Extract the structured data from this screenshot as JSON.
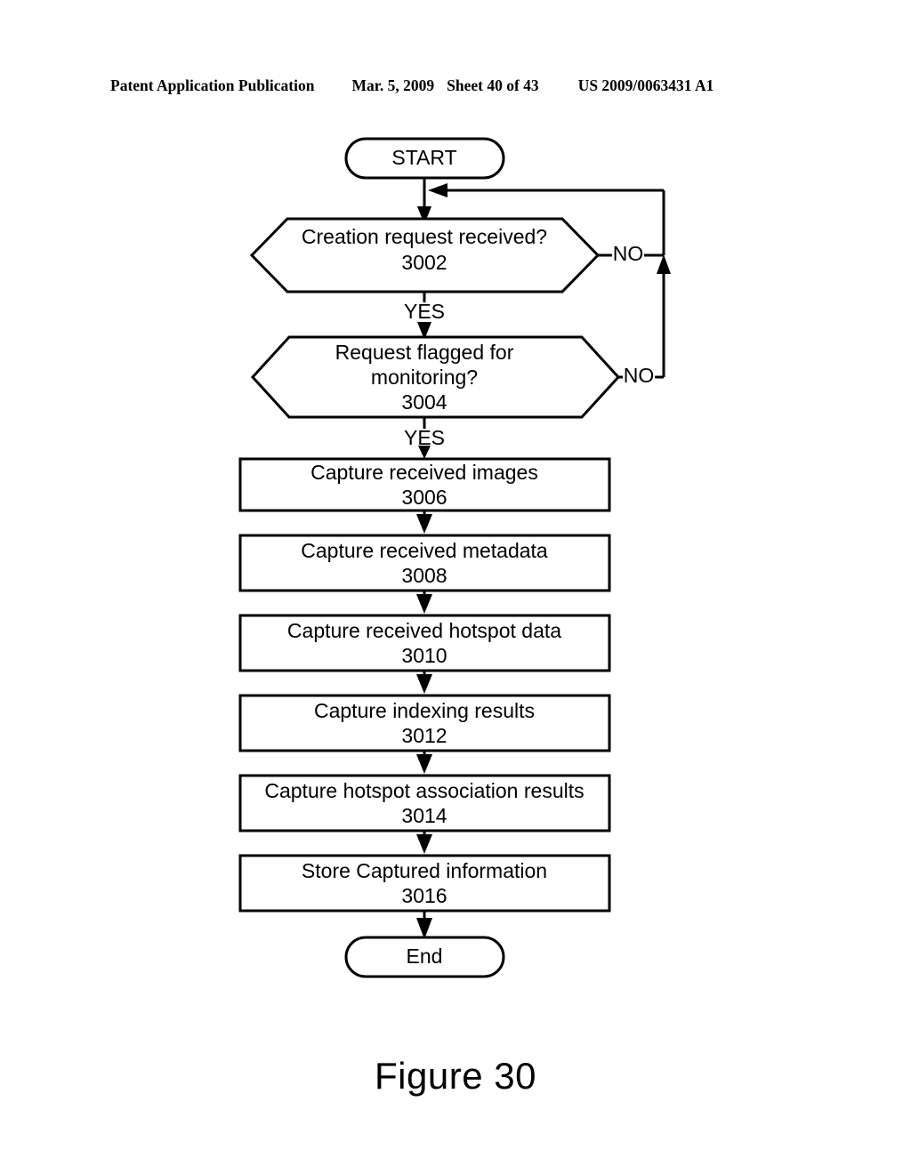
{
  "header": {
    "publication": "Patent Application Publication",
    "date": "Mar. 5, 2009",
    "sheet": "Sheet 40 of 43",
    "patent_number": "US 2009/0063431 A1"
  },
  "figure": {
    "caption": "Figure 30"
  },
  "flowchart": {
    "nodes": [
      {
        "id": "start",
        "type": "terminator",
        "text_line1": "START"
      },
      {
        "id": "3002",
        "type": "decision",
        "text_line1": "Creation request received?",
        "text_line2": "3002"
      },
      {
        "id": "3004",
        "type": "decision",
        "text_line1": "Request flagged for",
        "text_line2": "monitoring?",
        "text_line3": "3004"
      },
      {
        "id": "3006",
        "type": "process",
        "text_line1": "Capture received images",
        "text_line2": "3006"
      },
      {
        "id": "3008",
        "type": "process",
        "text_line1": "Capture received metadata",
        "text_line2": "3008"
      },
      {
        "id": "3010",
        "type": "process",
        "text_line1": "Capture received hotspot data",
        "text_line2": "3010"
      },
      {
        "id": "3012",
        "type": "process",
        "text_line1": "Capture indexing results",
        "text_line2": "3012"
      },
      {
        "id": "3014",
        "type": "process",
        "text_line1": "Capture hotspot association results",
        "text_line2": "3014"
      },
      {
        "id": "3016",
        "type": "process",
        "text_line1": "Store Captured information",
        "text_line2": "3016"
      },
      {
        "id": "end",
        "type": "terminator",
        "text_line1": "End"
      }
    ],
    "edge_labels": {
      "no_3002": "NO",
      "yes_3002": "YES",
      "no_3004": "NO",
      "yes_3004": "YES"
    }
  }
}
